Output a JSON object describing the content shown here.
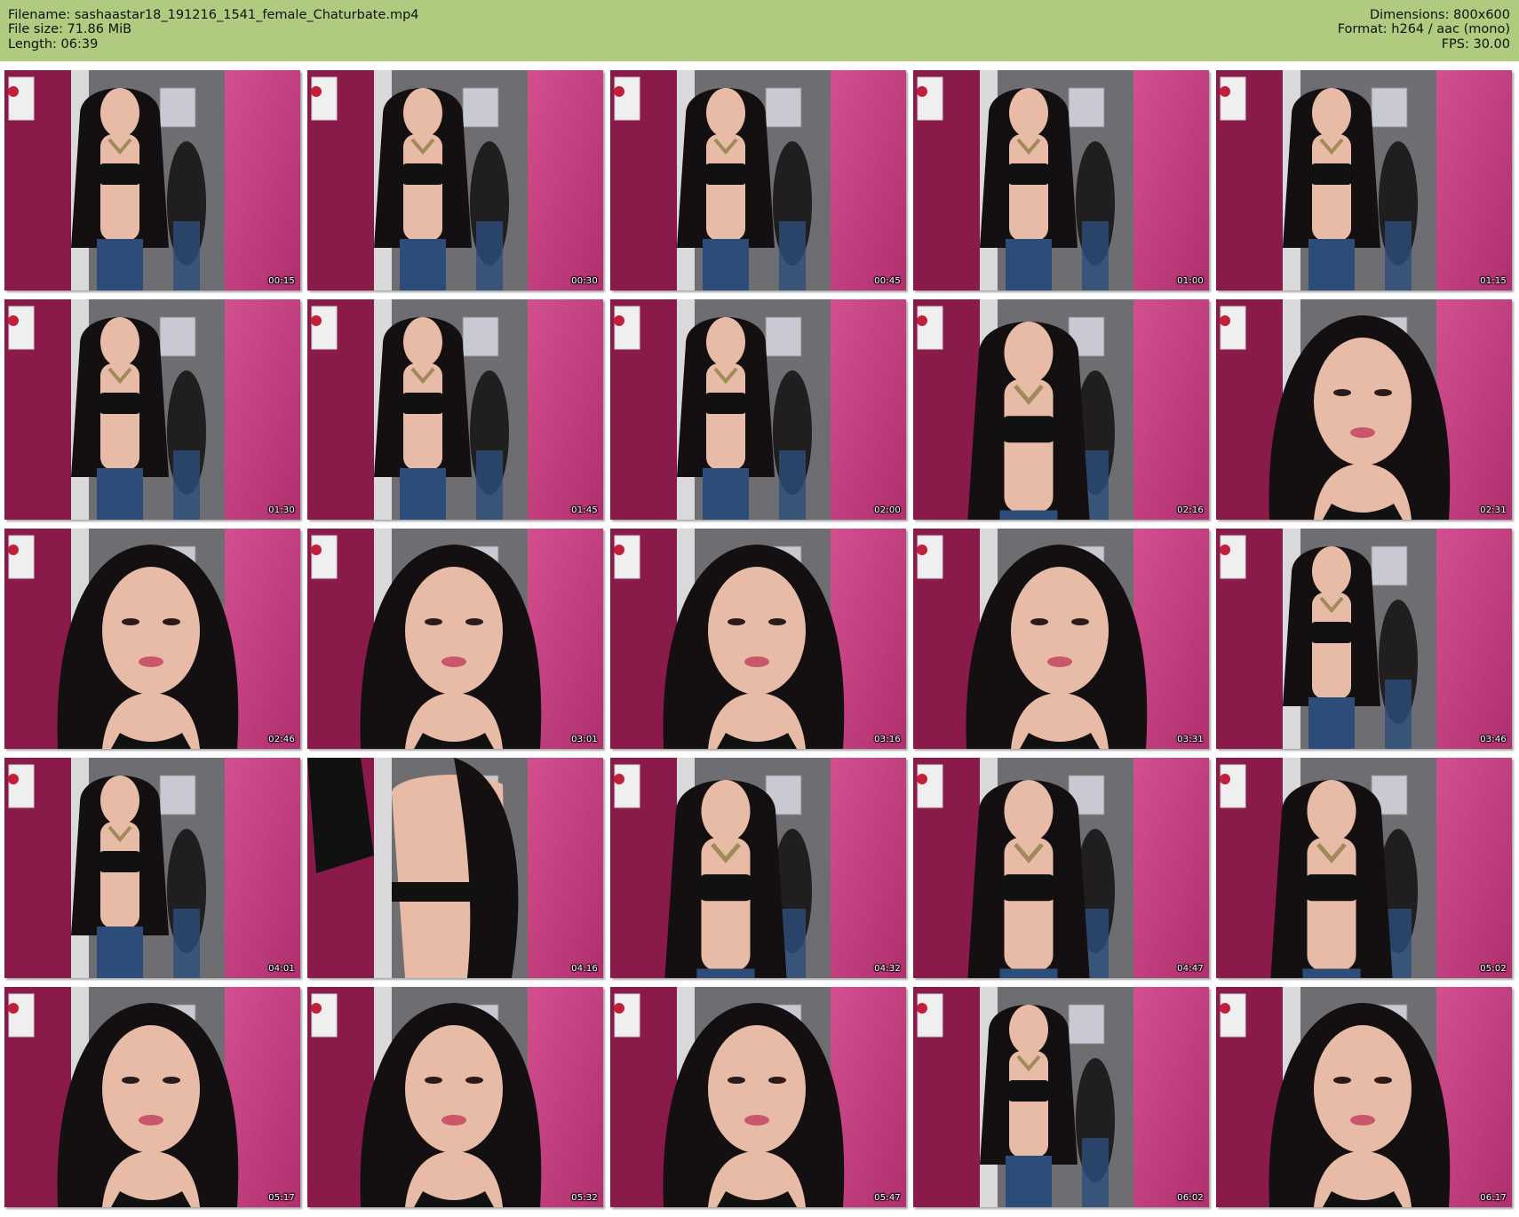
{
  "header": {
    "filename_line": "Filename: sashaastar18_191216_1541_female_Chaturbate.mp4",
    "filesize_line": "File size: 71.86 MiB",
    "length_line": "Length: 06:39",
    "dimensions_line": "Dimensions: 800x600",
    "format_line": "Format: h264 / aac (mono)",
    "fps_line": "FPS: 30.00"
  },
  "colors": {
    "header_bg": "#aecb7f",
    "wall_magenta": "#8a1a4a",
    "wall_pink": "#d2508f",
    "wall_gray": "#6e6e72",
    "hair": "#141012",
    "skin": "#e8bba6",
    "clothing_black": "#111111",
    "jeans_blue": "#2c4d7a"
  },
  "thumbnails": [
    {
      "timestamp": "00:15",
      "scene": "full"
    },
    {
      "timestamp": "00:30",
      "scene": "full"
    },
    {
      "timestamp": "00:45",
      "scene": "full"
    },
    {
      "timestamp": "01:00",
      "scene": "full"
    },
    {
      "timestamp": "01:15",
      "scene": "full"
    },
    {
      "timestamp": "01:30",
      "scene": "full"
    },
    {
      "timestamp": "01:45",
      "scene": "full"
    },
    {
      "timestamp": "02:00",
      "scene": "full"
    },
    {
      "timestamp": "02:16",
      "scene": "medium"
    },
    {
      "timestamp": "02:31",
      "scene": "close"
    },
    {
      "timestamp": "02:46",
      "scene": "close"
    },
    {
      "timestamp": "03:01",
      "scene": "close"
    },
    {
      "timestamp": "03:16",
      "scene": "close"
    },
    {
      "timestamp": "03:31",
      "scene": "close"
    },
    {
      "timestamp": "03:46",
      "scene": "full"
    },
    {
      "timestamp": "04:01",
      "scene": "full"
    },
    {
      "timestamp": "04:16",
      "scene": "back"
    },
    {
      "timestamp": "04:32",
      "scene": "medium"
    },
    {
      "timestamp": "04:47",
      "scene": "medium"
    },
    {
      "timestamp": "05:02",
      "scene": "medium"
    },
    {
      "timestamp": "05:17",
      "scene": "close"
    },
    {
      "timestamp": "05:32",
      "scene": "close"
    },
    {
      "timestamp": "05:47",
      "scene": "close"
    },
    {
      "timestamp": "06:02",
      "scene": "full"
    },
    {
      "timestamp": "06:17",
      "scene": "close"
    }
  ]
}
